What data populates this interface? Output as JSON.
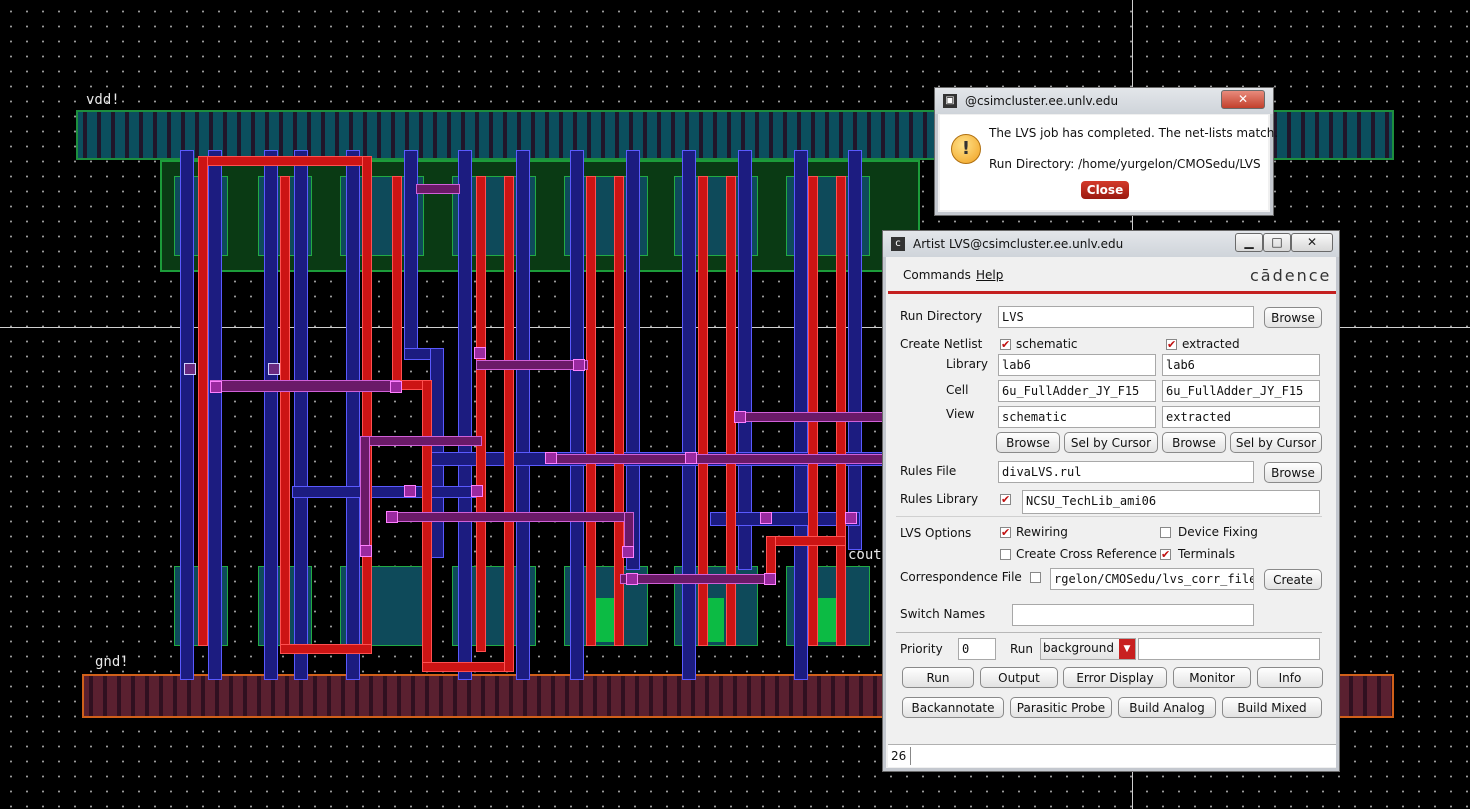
{
  "layout": {
    "vdd_label": "vdd!",
    "gnd_label": "gnd!",
    "cout_label": "cout"
  },
  "message_box": {
    "title": "@csimcluster.ee.unlv.edu",
    "line1": "The LVS job has completed. The net-lists match.",
    "line2": "Run Directory: /home/yurgelon/CMOSedu/LVS",
    "close_label": "Close",
    "icon": "warning-icon"
  },
  "lvs": {
    "title": "Artist LVS@csimcluster.ee.unlv.edu",
    "menu": [
      "Commands",
      "Help"
    ],
    "brand": "cādence",
    "run_directory_label": "Run Directory",
    "run_directory_value": "LVS",
    "browse_label": "Browse",
    "create_netlist_label": "Create Netlist",
    "schematic_label": "schematic",
    "extracted_label": "extracted",
    "library_label": "Library",
    "cell_label": "Cell",
    "view_label": "View",
    "sch_library": "lab6",
    "sch_cell": "6u_FullAdder_JY_F15",
    "sch_view": "schematic",
    "ext_library": "lab6",
    "ext_cell": "6u_FullAdder_JY_F15",
    "ext_view": "extracted",
    "sel_by_cursor_label": "Sel by Cursor",
    "rules_file_label": "Rules File",
    "rules_file_value": "divaLVS.rul",
    "rules_library_label": "Rules Library",
    "rules_library_value": "NCSU_TechLib_ami06",
    "lvs_options_label": "LVS Options",
    "rewiring_label": "Rewiring",
    "device_fixing_label": "Device Fixing",
    "create_xref_label": "Create Cross Reference",
    "terminals_label": "Terminals",
    "correspondence_label": "Correspondence File",
    "correspondence_value": "rgelon/CMOSedu/lvs_corr_file",
    "create_label": "Create",
    "switch_names_label": "Switch Names",
    "switch_names_value": "",
    "priority_label": "Priority",
    "priority_value": "0",
    "run_label": "Run",
    "run_mode": "background",
    "buttons_row1": [
      "Run",
      "Output",
      "Error Display",
      "Monitor",
      "Info"
    ],
    "buttons_row2": [
      "Backannotate",
      "Parasitic Probe",
      "Build Analog",
      "Build Mixed"
    ],
    "status_number": "26",
    "checks": {
      "schematic": true,
      "extracted": true,
      "rules_library": true,
      "rewiring": true,
      "device_fixing": false,
      "create_xref": false,
      "terminals": true,
      "correspondence": false
    }
  }
}
